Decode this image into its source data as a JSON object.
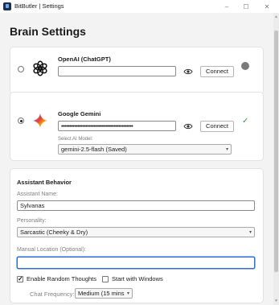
{
  "window": {
    "title": "BitButler | Settings",
    "controls": {
      "minimize": "–",
      "maximize": "☐",
      "close": "✕"
    }
  },
  "page": {
    "title": "Brain Settings"
  },
  "providers": {
    "openai": {
      "name": "OpenAI (ChatGPT)",
      "selected": false,
      "api_key_value": "",
      "connect_label": "Connect",
      "status": "disconnected",
      "status_color": "#7a7a7a",
      "icon": "openai-logo-icon"
    },
    "gemini": {
      "name": "Google Gemini",
      "selected": true,
      "api_key_value": "••••••••••••••••••••••••••••••••••••••••••••",
      "connect_label": "Connect",
      "status": "connected",
      "status_symbol": "✓",
      "status_color": "#2e9e3e",
      "model_label": "Select AI Model:",
      "model_value": "gemini-2.5-flash (Saved)",
      "icon": "gemini-logo-icon"
    }
  },
  "behavior": {
    "section_title": "Assistant Behavior",
    "assistant_name_label": "Assistant Name:",
    "assistant_name_value": "Sylvanas",
    "personality_label": "Personality:",
    "personality_value": "Sarcastic (Cheeky & Dry)",
    "manual_location_label": "Manual Location (Optional):",
    "manual_location_value": "",
    "random_thoughts_label": "Enable Random Thoughts",
    "random_thoughts_checked": true,
    "start_with_windows_label": "Start with Windows",
    "start_with_windows_checked": false,
    "chat_frequency_label": "Chat Frequency:",
    "chat_frequency_value": "Medium (15 mins"
  },
  "icons": {
    "eye": "eye-icon",
    "chevron": "▾"
  }
}
